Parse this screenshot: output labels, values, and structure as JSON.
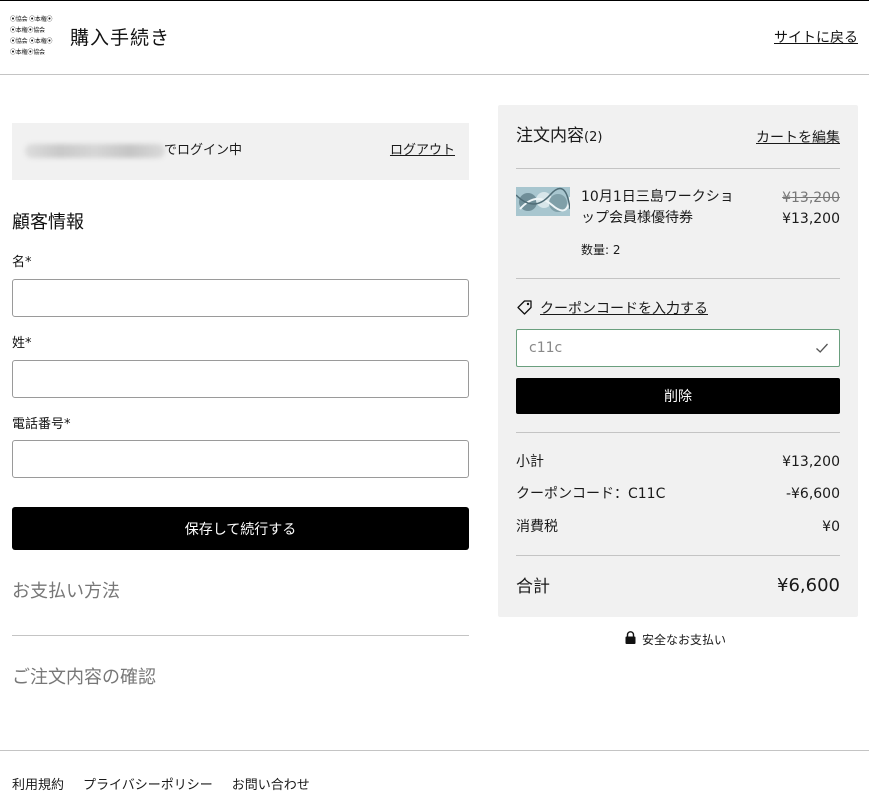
{
  "header": {
    "logo_lines": [
      "⦿協会 ⦿本権⦿",
      "⦿本権⦿協会",
      "⦿協会 ⦿本権⦿",
      "⦿本権⦿協会"
    ],
    "title": "購入手続き",
    "back_link": "サイトに戻る"
  },
  "login": {
    "status": "でログイン中",
    "logout": "ログアウト"
  },
  "customer": {
    "section_title": "顧客情報",
    "first_name_label": "名*",
    "last_name_label": "姓*",
    "phone_label": "電話番号*",
    "first_name_value": "",
    "last_name_value": "",
    "phone_value": "",
    "save_button": "保存して続行する"
  },
  "payment": {
    "title": "お支払い方法"
  },
  "review": {
    "title": "ご注文内容の確認"
  },
  "summary": {
    "title": "注文内容",
    "count": "(2)",
    "edit_cart": "カートを編集",
    "item": {
      "name": "10月1日三島ワークショップ会員様優待券",
      "original_price": "¥13,200",
      "price": "¥13,200",
      "quantity": "数量: 2"
    },
    "coupon_link": "クーポンコードを入力する",
    "coupon_value": "c11c",
    "delete_button": "削除",
    "subtotal_label": "小計",
    "subtotal_value": "¥13,200",
    "coupon_label": "クーポンコード：C11C",
    "coupon_discount": "-¥6,600",
    "tax_label": "消費税",
    "tax_value": "¥0",
    "total_label": "合計",
    "total_value": "¥6,600"
  },
  "secure_payment": "安全なお支払い",
  "footer": {
    "links": [
      "利用規約",
      "プライバシーポリシー",
      "お問い合わせ"
    ]
  },
  "colors": {
    "accent_button": "#000000",
    "panel_bg": "#f1f1f1",
    "valid_border": "#6a9f7e"
  }
}
